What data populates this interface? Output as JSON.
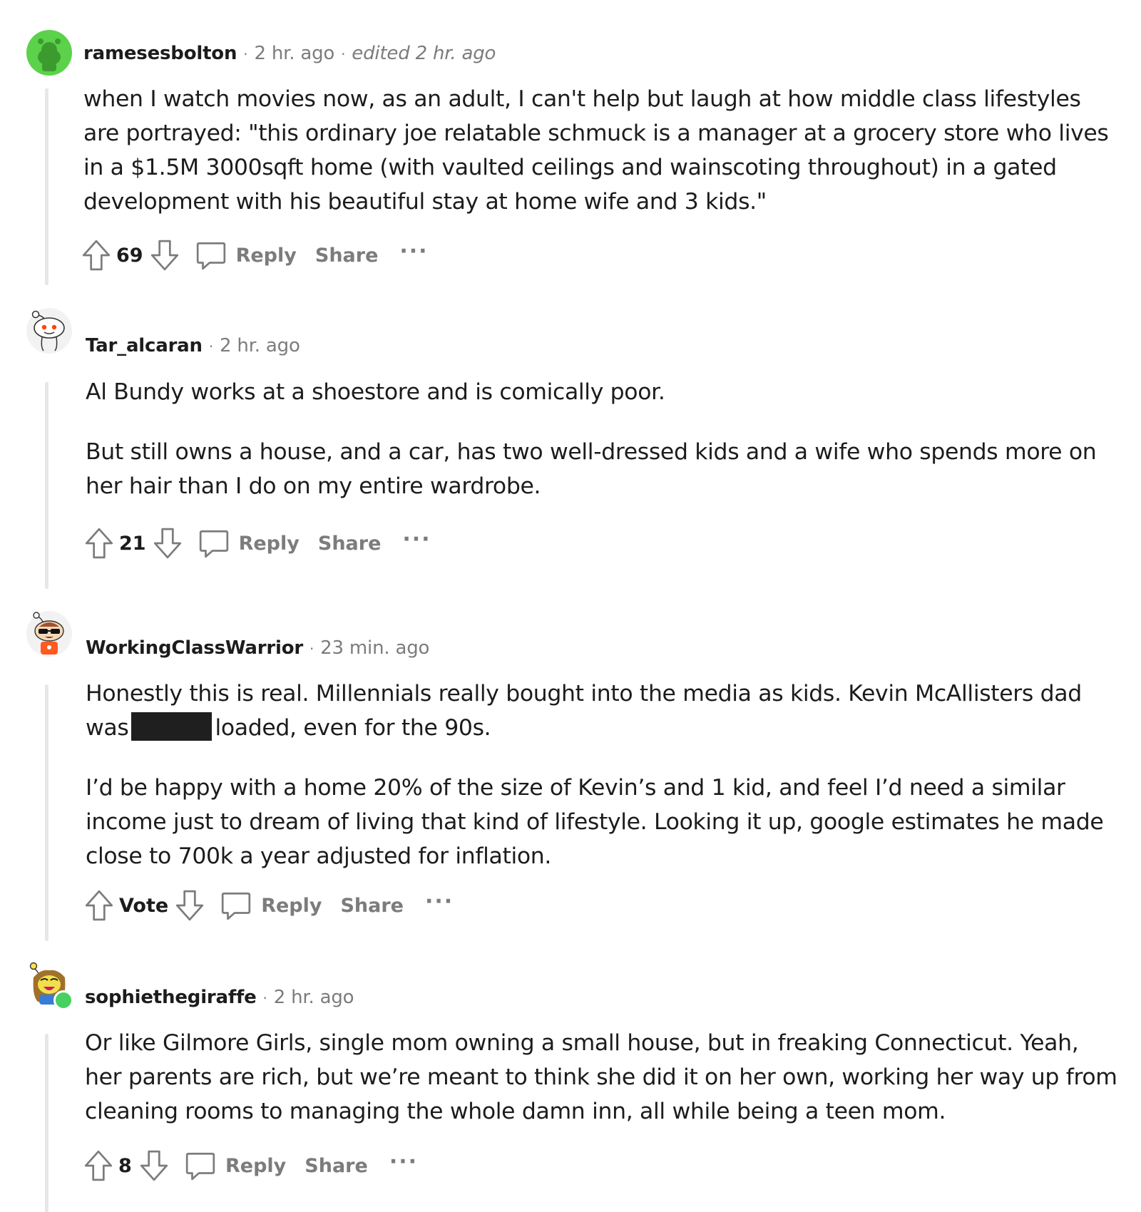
{
  "comments": [
    {
      "author": "ramesesbolton",
      "time": "2 hr. ago",
      "edited": "edited 2 hr. ago",
      "paragraphs": [
        "when I watch movies now, as an adult, I can't help but laugh at how middle class lifestyles are portrayed: \"this ordinary joe relatable schmuck is a manager at a grocery store who lives in a $1.5M 3000sqft home (with vaulted ceilings and wainscoting throughout) in a gated development with his beautiful stay at home wife and 3 kids.\""
      ],
      "score": "69",
      "reply_label": "Reply",
      "share_label": "Share",
      "more_label": "···"
    },
    {
      "author": "Tar_alcaran",
      "time": "2 hr. ago",
      "paragraphs": [
        "Al Bundy works at a shoestore and is comically poor.",
        "But still owns a house, and a car, has two well-dressed kids and a wife who spends more on her hair than I do on my entire wardrobe."
      ],
      "score": "21",
      "reply_label": "Reply",
      "share_label": "Share",
      "more_label": "···"
    },
    {
      "author": "WorkingClassWarrior",
      "time": "23 min. ago",
      "paragraphs": [
        "Honestly this is real. Millennials really bought into the media as kids. Kevin McAllisters dad was",
        "loaded, even for the 90s.",
        "I’d be happy with a home 20% of the size of Kevin’s and 1 kid, and feel I’d need a similar income just to dream of living that kind of lifestyle. Looking it up, google estimates he made close to 700k a year adjusted for inflation."
      ],
      "score": "Vote",
      "reply_label": "Reply",
      "share_label": "Share",
      "more_label": "···"
    },
    {
      "author": "sophiethegiraffe",
      "time": "2 hr. ago",
      "paragraphs": [
        "Or like Gilmore Girls, single mom owning a small house, but in freaking Connecticut. Yeah, her parents are rich, but we’re meant to think she did it on her own, working her way up from cleaning rooms to managing the whole damn inn, all while being a teen mom."
      ],
      "score": "8",
      "reply_label": "Reply",
      "share_label": "Share",
      "more_label": "···"
    }
  ],
  "separator": "·",
  "icons": {
    "upvote": "upvote-arrow-icon",
    "downvote": "downvote-arrow-icon",
    "reply": "speech-bubble-icon",
    "avatar_1": "green-snoo-avatar",
    "avatar_2": "white-snoo-avatar",
    "avatar_3": "sunglasses-snoo-avatar",
    "avatar_4": "giraffe-snoo-avatar"
  },
  "colors": {
    "text": "#1c1c1c",
    "meta": "#7c7c7c",
    "thread_line": "#e5e8ea",
    "spoiler": "#1f1f1f",
    "online": "#46d160",
    "avatar_green": "#5bd24a"
  }
}
